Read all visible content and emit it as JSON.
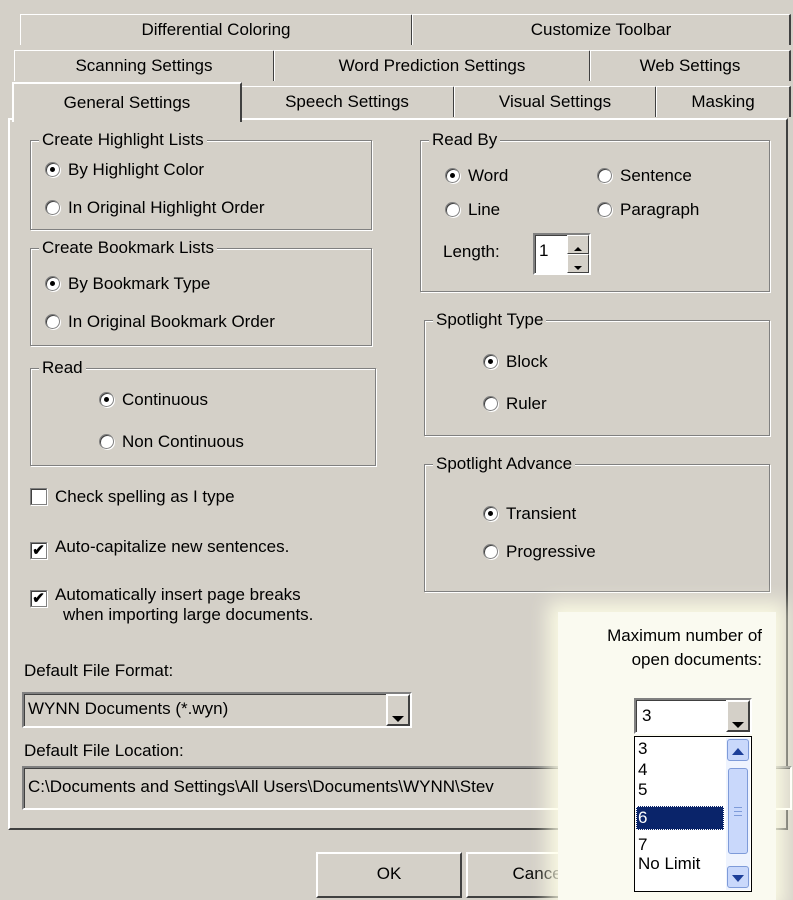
{
  "tabs": {
    "row1": [
      "Differential Coloring",
      "Customize Toolbar"
    ],
    "row2": [
      "Scanning Settings",
      "Word Prediction Settings",
      "Web Settings"
    ],
    "row3": [
      "General Settings",
      "Speech Settings",
      "Visual Settings",
      "Masking"
    ],
    "active": "General Settings"
  },
  "highlight_lists": {
    "title": "Create Highlight Lists",
    "options": [
      {
        "label": "By Highlight Color",
        "selected": true
      },
      {
        "label": "In Original Highlight Order",
        "selected": false
      }
    ]
  },
  "bookmark_lists": {
    "title": "Create Bookmark Lists",
    "options": [
      {
        "label": "By Bookmark Type",
        "selected": true
      },
      {
        "label": "In Original Bookmark Order",
        "selected": false
      }
    ]
  },
  "read": {
    "title": "Read",
    "options": [
      {
        "label": "Continuous",
        "selected": true
      },
      {
        "label": "Non Continuous",
        "selected": false
      }
    ]
  },
  "read_by": {
    "title": "Read By",
    "options": [
      {
        "label": "Word",
        "selected": true
      },
      {
        "label": "Sentence",
        "selected": false
      },
      {
        "label": "Line",
        "selected": false
      },
      {
        "label": "Paragraph",
        "selected": false
      }
    ],
    "length_label": "Length:",
    "length_value": "1"
  },
  "spotlight_type": {
    "title": "Spotlight Type",
    "options": [
      {
        "label": "Block",
        "selected": true
      },
      {
        "label": "Ruler",
        "selected": false
      }
    ]
  },
  "spotlight_advance": {
    "title": "Spotlight Advance",
    "options": [
      {
        "label": "Transient",
        "selected": true
      },
      {
        "label": "Progressive",
        "selected": false
      }
    ]
  },
  "checkboxes": [
    {
      "label": "Check spelling as I type",
      "checked": false
    },
    {
      "label": "Auto-capitalize new sentences.",
      "checked": true
    },
    {
      "label": "Automatically insert page breaks",
      "label2": "when importing large documents.",
      "checked": true
    }
  ],
  "default_file_format": {
    "label": "Default File Format:",
    "value": "WYNN Documents (*.wyn)"
  },
  "default_file_location": {
    "label": "Default File Location:",
    "value": "C:\\Documents and Settings\\All Users\\Documents\\WYNN\\Stev"
  },
  "max_docs": {
    "label_line1": "Maximum number of",
    "label_line2": "open documents:",
    "value": "3",
    "options": [
      "3",
      "4",
      "5",
      "6",
      "7",
      "No Limit"
    ],
    "highlighted": "6"
  },
  "buttons": {
    "ok": "OK",
    "cancel": "Cancel"
  },
  "check_mark": "✔"
}
